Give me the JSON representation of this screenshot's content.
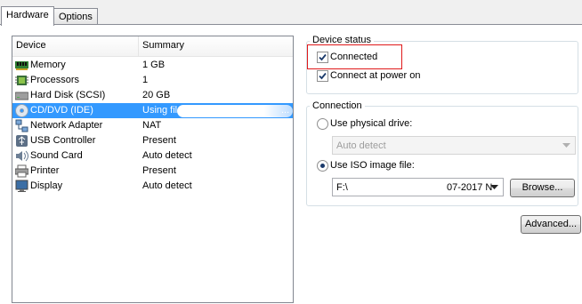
{
  "tabs": [
    {
      "label": "Hardware"
    },
    {
      "label": "Options"
    }
  ],
  "device_list": {
    "columns": [
      "Device",
      "Summary"
    ],
    "rows": [
      {
        "device": "Memory",
        "summary": "1 GB",
        "icon": "memory-icon"
      },
      {
        "device": "Processors",
        "summary": "1",
        "icon": "processor-icon"
      },
      {
        "device": "Hard Disk (SCSI)",
        "summary": "20 GB",
        "icon": "hard-disk-icon"
      },
      {
        "device": "CD/DVD (IDE)",
        "summary": "Using file",
        "icon": "cd-dvd-icon",
        "selected": true
      },
      {
        "device": "Network Adapter",
        "summary": "NAT",
        "icon": "network-adapter-icon"
      },
      {
        "device": "USB Controller",
        "summary": "Present",
        "icon": "usb-icon"
      },
      {
        "device": "Sound Card",
        "summary": "Auto detect",
        "icon": "sound-card-icon"
      },
      {
        "device": "Printer",
        "summary": "Present",
        "icon": "printer-icon"
      },
      {
        "device": "Display",
        "summary": "Auto detect",
        "icon": "display-icon"
      }
    ],
    "selected_trailing": "..."
  },
  "device_status": {
    "title": "Device status",
    "connected_label": "Connected",
    "connected_checked": true,
    "connect_power_label": "Connect at power on",
    "connect_power_checked": true
  },
  "connection": {
    "title": "Connection",
    "physical_label": "Use physical drive:",
    "physical_selected": false,
    "physical_value": "Auto detect",
    "iso_label": "Use ISO image file:",
    "iso_selected": true,
    "iso_path_start": "F:\\",
    "iso_path_end": "07-2017 N",
    "browse_label": "Browse..."
  },
  "advanced_label": "Advanced...",
  "colors": {
    "selection": "#3399ff",
    "highlight_box": "#e0191b"
  }
}
